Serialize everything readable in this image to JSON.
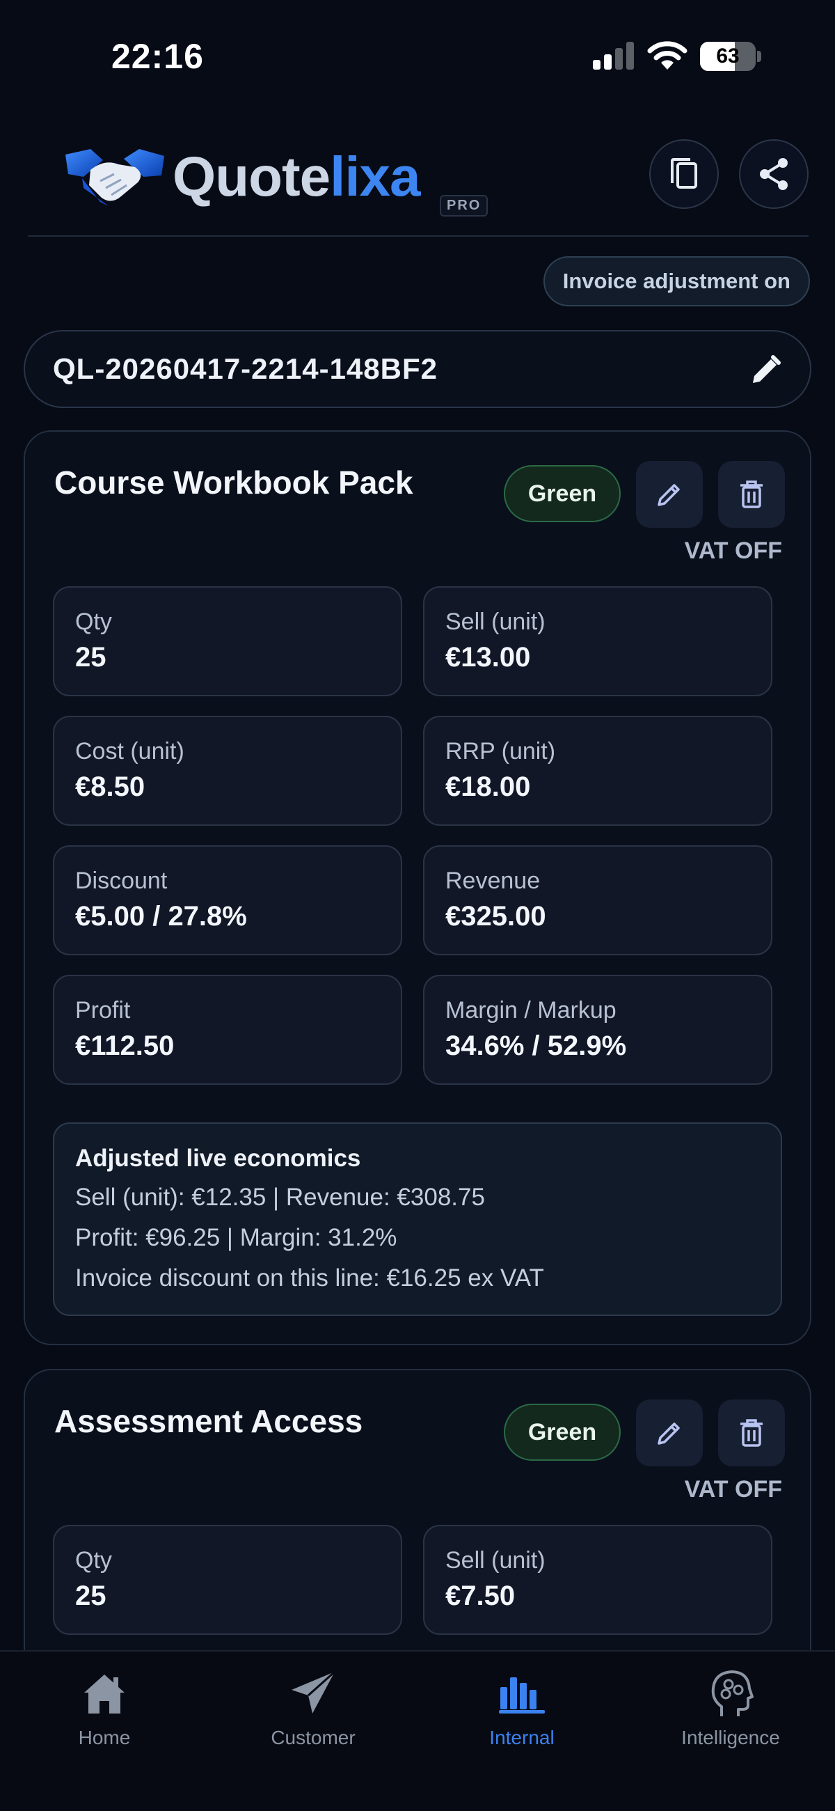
{
  "status_bar": {
    "time": "22:16",
    "battery": "63",
    "battery_fraction": 0.63
  },
  "header": {
    "logo_text_main": "Quote",
    "logo_text_accent": "lixa",
    "logo_badge": "PRO",
    "icons": [
      "copy-icon",
      "share-icon"
    ]
  },
  "invoice_pill": "Invoice adjustment on",
  "quote_id": "QL-20260417-2214-148BF2",
  "items": [
    {
      "title": "Course Workbook Pack",
      "status": "Green",
      "vat": "VAT OFF",
      "metrics": {
        "qty_label": "Qty",
        "qty": "25",
        "sell_label": "Sell (unit)",
        "sell": "€13.00",
        "cost_label": "Cost (unit)",
        "cost": "€8.50",
        "rrp_label": "RRP (unit)",
        "rrp": "€18.00",
        "discount_label": "Discount",
        "discount": "€5.00 / 27.8%",
        "revenue_label": "Revenue",
        "revenue": "€325.00",
        "profit_label": "Profit",
        "profit": "€112.50",
        "margin_label": "Margin / Markup",
        "margin": "34.6% / 52.9%"
      },
      "adjusted": {
        "title": "Adjusted live economics",
        "line1": "Sell (unit): €12.35 | Revenue: €308.75",
        "line2": "Profit: €96.25 | Margin: 31.2%",
        "line3": "Invoice discount on this line: €16.25 ex VAT"
      }
    },
    {
      "title": "Assessment Access",
      "status": "Green",
      "vat": "VAT OFF",
      "metrics": {
        "qty_label": "Qty",
        "qty": "25",
        "sell_label": "Sell (unit)",
        "sell": "€7.50"
      }
    }
  ],
  "tabs": [
    {
      "label": "Home",
      "icon": "home-icon",
      "active": false
    },
    {
      "label": "Customer",
      "icon": "paper-plane-icon",
      "active": false
    },
    {
      "label": "Internal",
      "icon": "bar-chart-icon",
      "active": true
    },
    {
      "label": "Intelligence",
      "icon": "brain-head-icon",
      "active": false
    }
  ],
  "colors": {
    "background": "#070b16",
    "accent": "#3a82f0",
    "status_green": "#2b6a45"
  }
}
